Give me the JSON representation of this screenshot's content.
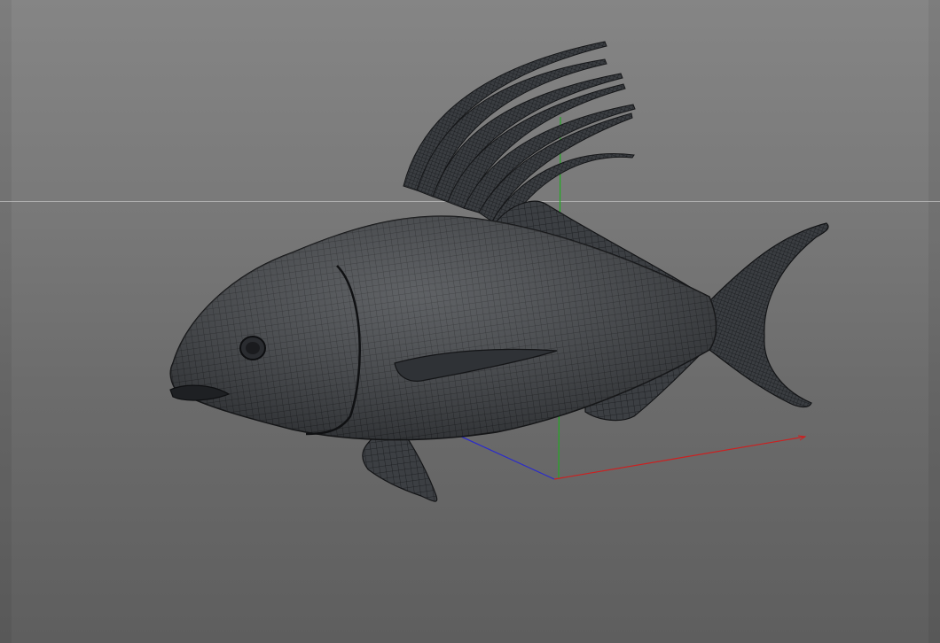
{
  "viewport": {
    "background_top": "#858585",
    "background_bottom": "#5e5e5e",
    "horizon_color": "#b9b9b9"
  },
  "model": {
    "shading": "wireframe-on-shaded",
    "body_color": "#3a3d40",
    "wire_color": "#15171a"
  },
  "axes": {
    "x_color": "#d02020",
    "y_color": "#20b020",
    "z_color": "#2020d0"
  }
}
